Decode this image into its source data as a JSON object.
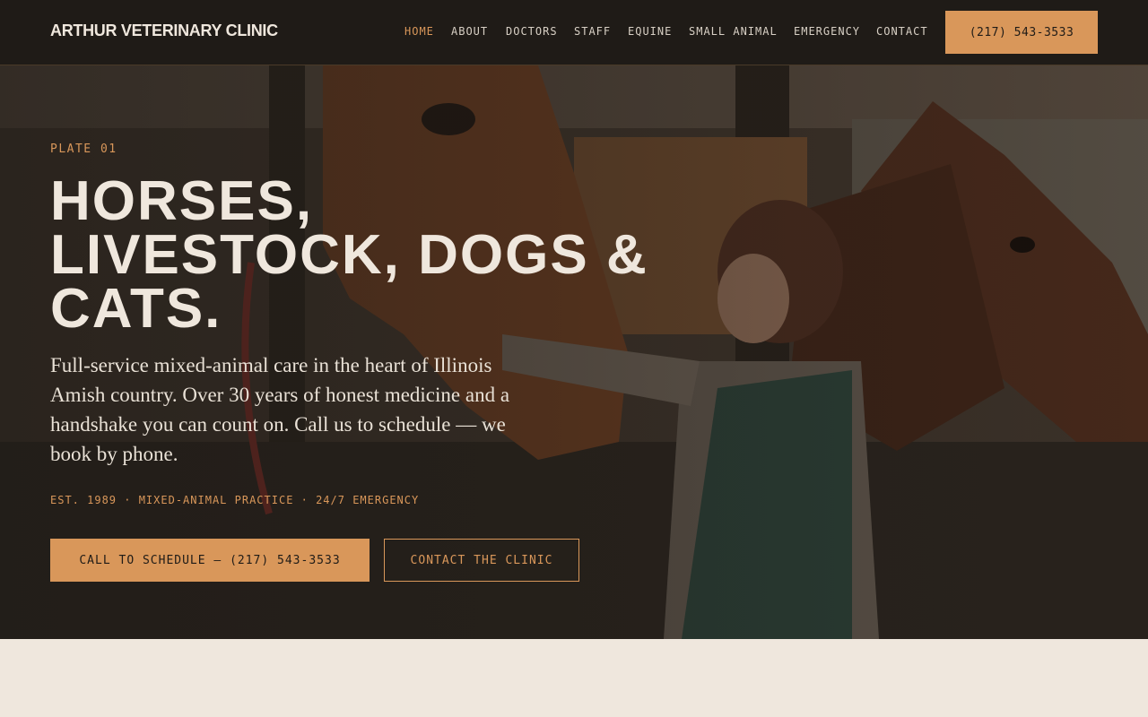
{
  "header": {
    "brand": "ARTHUR VETERINARY CLINIC",
    "nav": [
      {
        "label": "HOME",
        "active": true
      },
      {
        "label": "ABOUT",
        "active": false
      },
      {
        "label": "DOCTORS",
        "active": false
      },
      {
        "label": "STAFF",
        "active": false
      },
      {
        "label": "EQUINE",
        "active": false
      },
      {
        "label": "SMALL ANIMAL",
        "active": false
      },
      {
        "label": "EMERGENCY",
        "active": false
      },
      {
        "label": "CONTACT",
        "active": false
      }
    ],
    "phone_button": "(217) 543-3533"
  },
  "hero": {
    "eyebrow": "PLATE 01",
    "headline_line1": "HORSES,",
    "headline_line2": "LIVESTOCK, DOGS &",
    "headline_line3": "CATS.",
    "lede": "Full-service mixed-animal care in the heart of Illinois Amish country. Over 30 years of honest medicine and a handshake you can count on. Call us to schedule — we book by phone.",
    "meta": "EST. 1989 · MIXED-ANIMAL PRACTICE · 24/7 EMERGENCY",
    "primary_cta": "CALL TO SCHEDULE — (217) 543-3533",
    "secondary_cta": "CONTACT THE CLINIC"
  },
  "colors": {
    "nav_bg": "#1f1b17",
    "accent": "#d9975a",
    "text_light": "#efe7dd",
    "page_bg": "#efe7dd"
  }
}
